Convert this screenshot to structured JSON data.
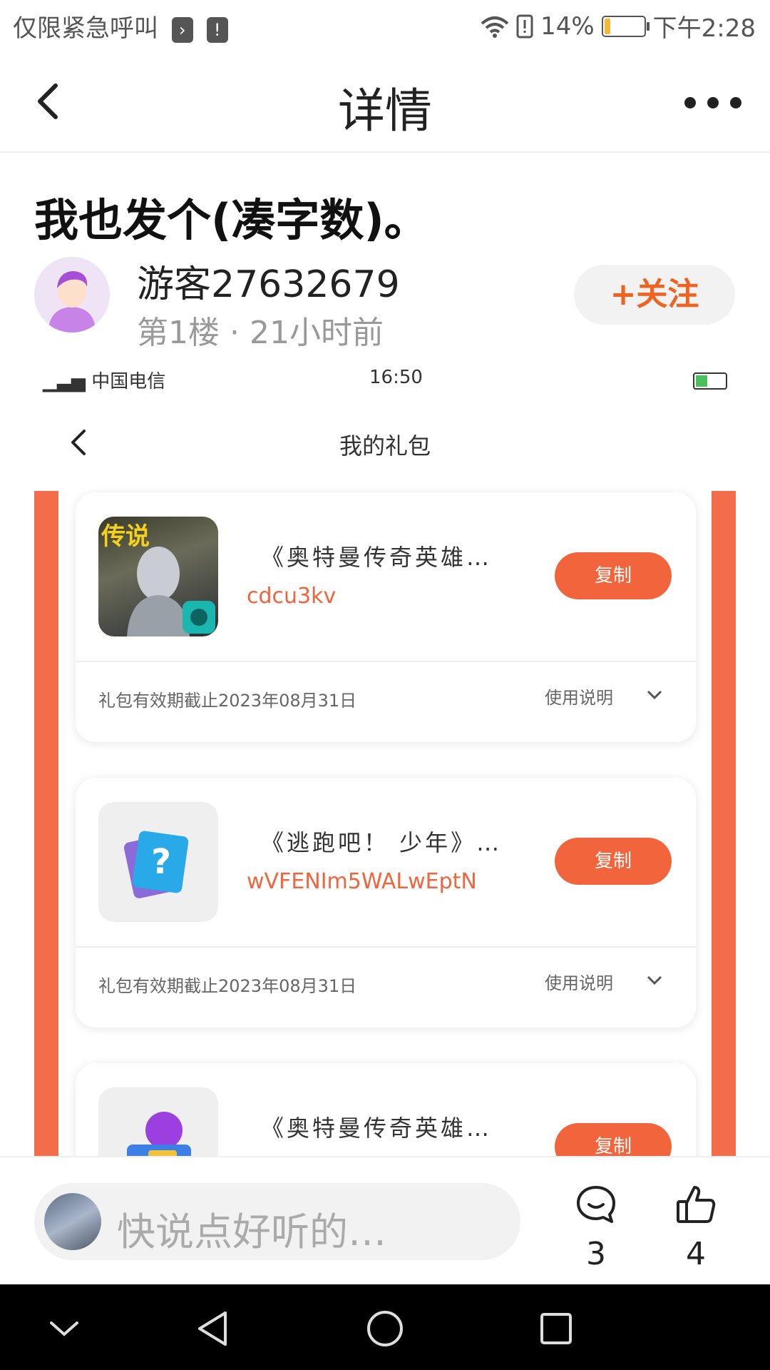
{
  "status_bar": {
    "carrier_text": "仅限紧急呼叫",
    "battery": "14%",
    "battery_level": 0.14,
    "time": "下午2:28"
  },
  "nav": {
    "title": "详情"
  },
  "post": {
    "title": "我也发个(凑字数)。",
    "username": "游客27632679",
    "meta": "第1楼 · 21小时前",
    "follow_label": "+关注"
  },
  "embedded": {
    "status_left": "中国电信",
    "status_time": "16:50",
    "title": "我的礼包",
    "gifts": [
      {
        "badge": "传说",
        "game": "《奥特曼传奇英雄…",
        "code": "cdcu3kv",
        "copy_label": "复制",
        "expiry": "礼包有效期截止2023年08月31日",
        "usage": "使用说明"
      },
      {
        "game": "《逃跑吧！ 少年》…",
        "code": "wVFENIm5WALwEptN",
        "copy_label": "复制",
        "expiry": "礼包有效期截止2023年08月31日",
        "usage": "使用说明"
      },
      {
        "game": "《奥特曼传奇英雄…",
        "copy_label": "复制"
      }
    ]
  },
  "bottom": {
    "placeholder": "快说点好听的…",
    "comment_count": "3",
    "like_count": "4"
  },
  "colors": {
    "accent": "#f0621f",
    "embed_orange": "#f46d4b",
    "copy_button": "#f2643c"
  }
}
